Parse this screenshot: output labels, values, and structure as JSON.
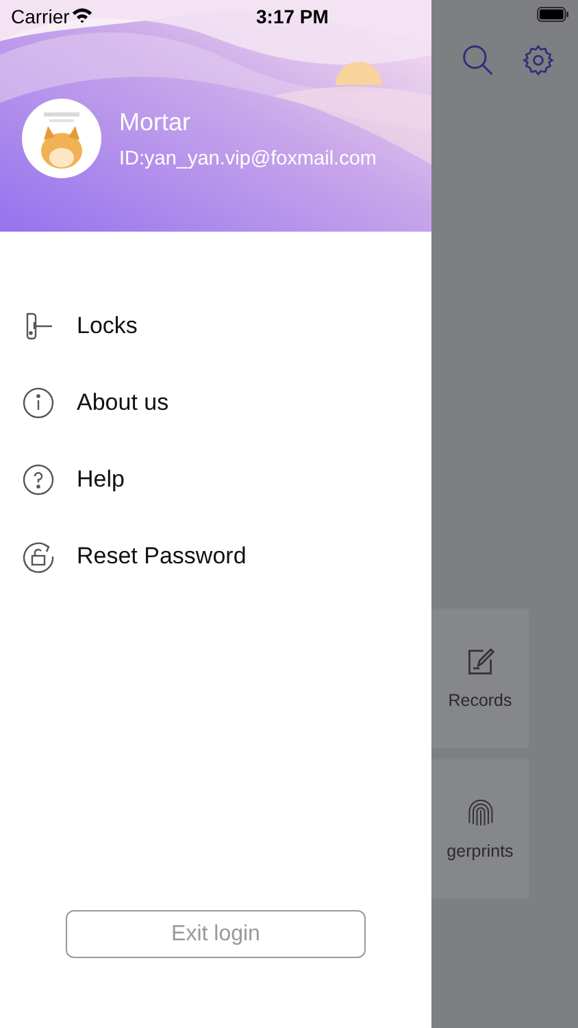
{
  "status_bar": {
    "carrier": "Carrier",
    "time": "3:17 PM"
  },
  "profile": {
    "name": "Mortar",
    "id": "ID:yan_yan.vip@foxmail.com"
  },
  "menu": [
    {
      "label": "Locks",
      "kind": "lock"
    },
    {
      "label": "About us",
      "kind": "info"
    },
    {
      "label": "Help",
      "kind": "help"
    },
    {
      "label": "Reset Password",
      "kind": "reset"
    }
  ],
  "exit_button": "Exit login",
  "background_page": {
    "cards": [
      {
        "label": "Records",
        "kind": "records"
      },
      {
        "label": "gerprints",
        "kind": "fingerprint"
      }
    ]
  }
}
